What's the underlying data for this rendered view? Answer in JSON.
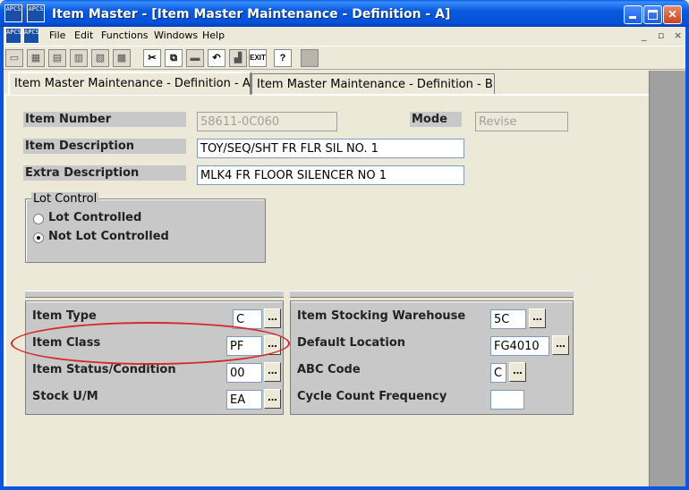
{
  "window": {
    "title": "Item Master - [Item Master Maintenance - Definition - A]",
    "icon_text": "APCS"
  },
  "menu": [
    "File",
    "Edit",
    "Functions",
    "Windows",
    "Help"
  ],
  "mdi_controls": [
    "_",
    "▫",
    "×"
  ],
  "tabs": [
    {
      "label": "Item Master Maintenance - Definition - A",
      "active": true
    },
    {
      "label": "Item Master Maintenance - Definition - B",
      "active": false
    }
  ],
  "form": {
    "item_number": {
      "label": "Item Number",
      "value": "58611-0C060"
    },
    "mode": {
      "label": "Mode",
      "value": "Revise"
    },
    "item_description": {
      "label": "Item Description",
      "value": "TOY/SEQ/SHT FR FLR SIL NO. 1"
    },
    "extra_description": {
      "label": "Extra Description",
      "value": "MLK4 FR FLOOR SILENCER NO 1"
    }
  },
  "lot_control": {
    "title": "Lot Control",
    "options": [
      {
        "label": "Lot Controlled",
        "checked": false
      },
      {
        "label": "Not Lot Controlled",
        "checked": true
      }
    ]
  },
  "left_section": [
    {
      "label": "Item Type",
      "value": "C"
    },
    {
      "label": "Item Class",
      "value": "PF"
    },
    {
      "label": "Item Status/Condition",
      "value": "00"
    },
    {
      "label": "Stock U/M",
      "value": "EA"
    }
  ],
  "right_section": [
    {
      "label": "Item Stocking Warehouse",
      "value": "5C"
    },
    {
      "label": "Default Location",
      "value": "FG4010"
    },
    {
      "label": "ABC Code",
      "value": "C"
    },
    {
      "label": "Cycle Count Frequency",
      "value": ""
    }
  ],
  "lookup_label": "...",
  "colors": {
    "title_bar": "#0a56dc",
    "highlight": "#d4292c",
    "section_bg": "#c8c8c8"
  }
}
